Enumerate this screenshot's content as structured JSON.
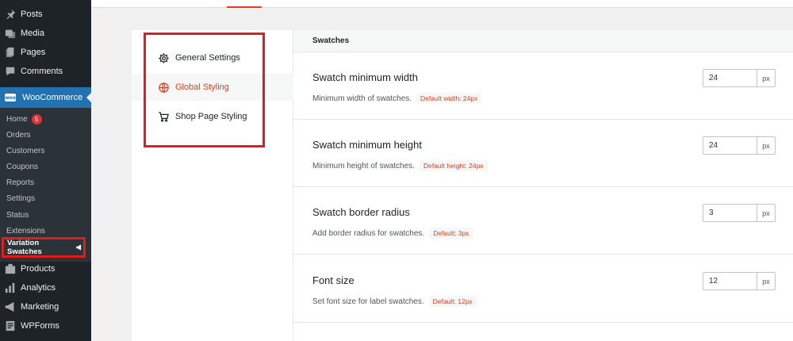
{
  "sidebar": {
    "top_items": [
      {
        "label": "Posts",
        "icon": "pin-icon"
      },
      {
        "label": "Media",
        "icon": "media-icon"
      },
      {
        "label": "Pages",
        "icon": "pages-icon"
      },
      {
        "label": "Comments",
        "icon": "comments-icon"
      }
    ],
    "woocommerce": {
      "label": "WooCommerce",
      "logo_text": "woo"
    },
    "submenu": [
      {
        "label": "Home",
        "badge": "5"
      },
      {
        "label": "Orders"
      },
      {
        "label": "Customers"
      },
      {
        "label": "Coupons"
      },
      {
        "label": "Reports"
      },
      {
        "label": "Settings"
      },
      {
        "label": "Status"
      },
      {
        "label": "Extensions"
      }
    ],
    "variation_swatches": "Variation Swatches",
    "bottom_items": [
      {
        "label": "Products",
        "icon": "products-icon"
      },
      {
        "label": "Analytics",
        "icon": "analytics-icon"
      },
      {
        "label": "Marketing",
        "icon": "marketing-icon"
      },
      {
        "label": "WPForms",
        "icon": "wpforms-icon"
      }
    ]
  },
  "tabs": [
    {
      "label": "General Settings",
      "icon": "gear-icon",
      "active": false
    },
    {
      "label": "Global Styling",
      "icon": "globe-icon",
      "active": true
    },
    {
      "label": "Shop Page Styling",
      "icon": "cart-icon",
      "active": false
    }
  ],
  "section": {
    "title": "Swatches"
  },
  "settings": [
    {
      "title": "Swatch minimum width",
      "description": "Minimum width of swatches.",
      "default": "Default width: 24px",
      "value": "24",
      "unit": "px"
    },
    {
      "title": "Swatch minimum height",
      "description": "Minimum height of swatches.",
      "default": "Default height: 24px",
      "value": "24",
      "unit": "px"
    },
    {
      "title": "Swatch border radius",
      "description": "Add border radius for swatches.",
      "default": "Default: 3px",
      "value": "3",
      "unit": "px"
    },
    {
      "title": "Font size",
      "description": "Set font size for label swatches.",
      "default": "Default: 12px",
      "value": "12",
      "unit": "px"
    }
  ],
  "colors": {
    "accent": "#e2401c",
    "wp_blue": "#2271b1",
    "sidebar_bg": "#1d2327",
    "highlight_border": "#e21b1b"
  }
}
